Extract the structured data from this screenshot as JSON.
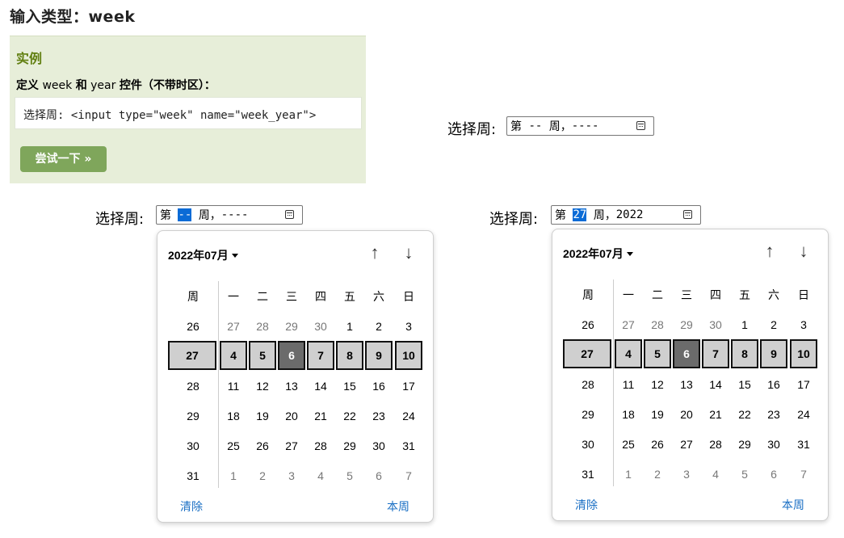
{
  "title": "输入类型：week",
  "example": {
    "heading": "实例",
    "desc_parts": [
      "定义",
      " week ",
      "和",
      " year ",
      "控件（不带时区）："
    ],
    "code": "选择周: <input type=\"week\" name=\"week_year\">",
    "try_button": "尝试一下 »"
  },
  "label": "选择周:",
  "inputs": [
    {
      "prefix": "第 ",
      "week": "--",
      "mid": " 周，",
      "year": "----"
    },
    {
      "prefix": "第 ",
      "week": "--",
      "mid": " 周，",
      "year": "----"
    },
    {
      "prefix": "第 ",
      "week": "27",
      "mid": " 周，",
      "year": "2022"
    }
  ],
  "calendar": {
    "month_label": "2022年07月",
    "week_header": "周",
    "weekdays": [
      "一",
      "二",
      "三",
      "四",
      "五",
      "六",
      "日"
    ],
    "rows": [
      {
        "week": "26",
        "days": [
          "27",
          "28",
          "29",
          "30",
          "1",
          "2",
          "3"
        ]
      },
      {
        "week": "27",
        "days": [
          "4",
          "5",
          "6",
          "7",
          "8",
          "9",
          "10"
        ]
      },
      {
        "week": "28",
        "days": [
          "11",
          "12",
          "13",
          "14",
          "15",
          "16",
          "17"
        ]
      },
      {
        "week": "29",
        "days": [
          "18",
          "19",
          "20",
          "21",
          "22",
          "23",
          "24"
        ]
      },
      {
        "week": "30",
        "days": [
          "25",
          "26",
          "27",
          "28",
          "29",
          "30",
          "31"
        ]
      },
      {
        "week": "31",
        "days": [
          "1",
          "2",
          "3",
          "4",
          "5",
          "6",
          "7"
        ]
      }
    ],
    "selected_row": 1,
    "today_index": 2,
    "clear_label": "清除",
    "this_week_label": "本周",
    "up_arrow": "↑",
    "down_arrow": "↓"
  }
}
